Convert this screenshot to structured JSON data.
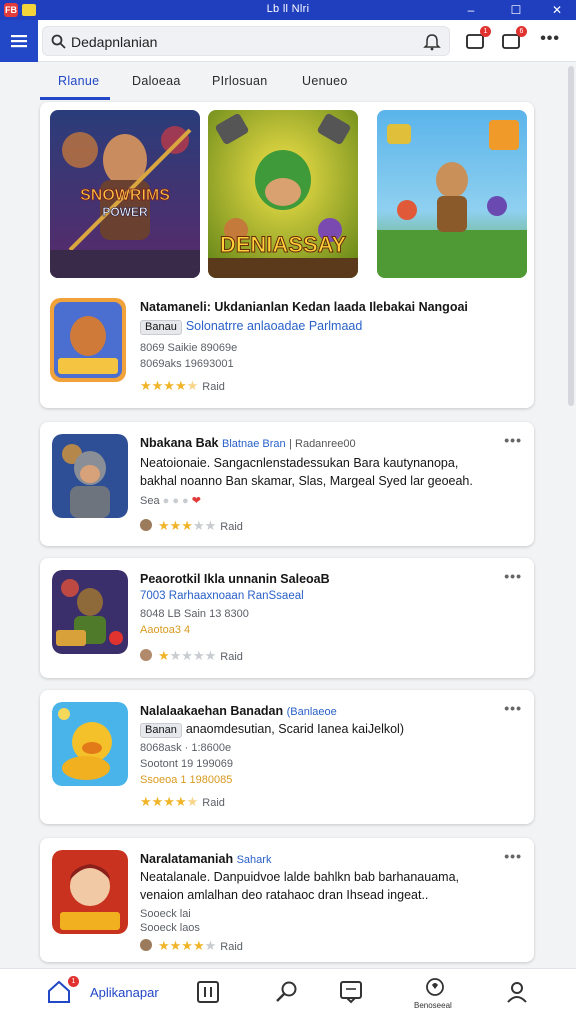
{
  "window": {
    "title": "Lb ll Nlri",
    "app_badge": "FB",
    "minimize": "–",
    "maximize": "☐",
    "close": "✕"
  },
  "toolbar": {
    "search_text": "Dedapnlanian",
    "notif1_badge": "1",
    "notif2_badge": "6",
    "more": "•••"
  },
  "tabs": [
    {
      "label": "Rlanue",
      "active": true
    },
    {
      "label": "Daloeaa",
      "active": false
    },
    {
      "label": "PIrlosuan",
      "active": false
    },
    {
      "label": "Uenueo",
      "active": false
    }
  ],
  "featured": {
    "banners": [
      {
        "name": "SNOWRIMS POWER",
        "title": "SNOWRIMS",
        "subtitle": "POWER"
      },
      {
        "name": "DENIASSAY",
        "title": "DENIASSAY"
      },
      {
        "name": "adventure-scene"
      }
    ],
    "item": {
      "title": "Natamaneli: Ukdanianlan Kedan laada Ilebakai Nangoai",
      "chip": "Banau",
      "subtitle_link": "Solonatrre anlaoadae Parlmaad",
      "meta1": "8069 Saikie 89069e",
      "meta2": "8069aks 19693001",
      "rating": 4.5,
      "rating_label": "Raid"
    }
  },
  "apps": [
    {
      "title": "Nbakana Bak",
      "title_link": "Blatnae Bran",
      "title_extra": "| Radanree00",
      "desc1": "Neatoionaie. Sangacnlenstadessukan Bara kautynanopa,",
      "desc2": "bakhal noanno Ban skamar, Slas, Margeal Syed lar geoeah.",
      "meta": "Sea",
      "rating": 3,
      "rating_label": "Raid",
      "more": "•••"
    },
    {
      "title": "Peaorotkil Ikla unnanin SaleoaB",
      "subtitle_link": "7003 Rarhaaxnoaan RanSsaeal",
      "meta1": "8048 LB Sain 13 8300",
      "meta2": "Aaotoa3 4",
      "rating": 1,
      "rating_label": "Raid",
      "more": "•••"
    },
    {
      "title": "Nalalaakaehan Banadan",
      "title_link": "(Banlaeoe",
      "chip": "Banan",
      "desc1": "anaomdesutian, Scarid Ianea kaiJelkol)",
      "meta1": "8068ask · 1:8600e",
      "meta2": "Sootont 19 199069",
      "meta3": "Ssoeoa 1 1980085",
      "rating": 4.5,
      "rating_label": "Raid",
      "more": "•••"
    },
    {
      "title": "Naralatamaniah",
      "title_link": "Sahark",
      "desc1": "Neatalanale. Danpuidvoe lalde bahlkn bab barhanauama,",
      "desc2": "venaion amlalhan deo ratahaoc dran Ihsead ingeat..",
      "meta1": "Sooeck lai",
      "meta2": "Sooeck laos",
      "rating": 4,
      "rating_label": "Raid",
      "more": "•••"
    }
  ],
  "bottom_nav": {
    "home_label": "Aplikanapar",
    "home_badge": "1",
    "small_label": "Benoseeal"
  },
  "colors": {
    "accent": "#2247c7",
    "star": "#f0b429",
    "link": "#2a61c9"
  }
}
